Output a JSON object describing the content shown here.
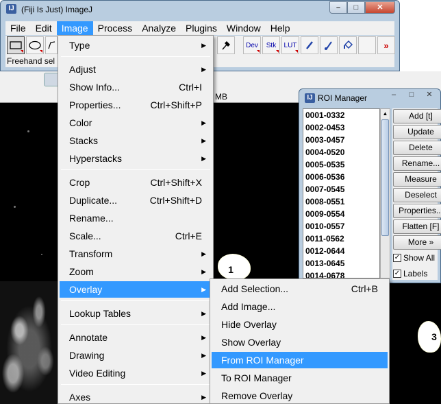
{
  "window": {
    "title": "(Fiji Is Just) ImageJ",
    "app_icon": "IJ"
  },
  "menubar": [
    "File",
    "Edit",
    "Image",
    "Process",
    "Analyze",
    "Plugins",
    "Window",
    "Help"
  ],
  "toolbar": {
    "status": "Freehand sel",
    "dev_label": "Dev",
    "stk_label": "Stk",
    "lut_label": "LUT",
    "more_label": "»"
  },
  "image_window": {
    "size_info": "MB"
  },
  "image_menu": {
    "items": [
      {
        "label": "Type",
        "shortcut": "",
        "submenu": true
      },
      {
        "label": "Adjust",
        "shortcut": "",
        "submenu": true
      },
      {
        "label": "Show Info...",
        "shortcut": "Ctrl+I",
        "submenu": false
      },
      {
        "label": "Properties...",
        "shortcut": "Ctrl+Shift+P",
        "submenu": false
      },
      {
        "label": "Color",
        "shortcut": "",
        "submenu": true
      },
      {
        "label": "Stacks",
        "shortcut": "",
        "submenu": true
      },
      {
        "label": "Hyperstacks",
        "shortcut": "",
        "submenu": true
      },
      {
        "label": "Crop",
        "shortcut": "Ctrl+Shift+X",
        "submenu": false
      },
      {
        "label": "Duplicate...",
        "shortcut": "Ctrl+Shift+D",
        "submenu": false
      },
      {
        "label": "Rename...",
        "shortcut": "",
        "submenu": false
      },
      {
        "label": "Scale...",
        "shortcut": "Ctrl+E",
        "submenu": false
      },
      {
        "label": "Transform",
        "shortcut": "",
        "submenu": true
      },
      {
        "label": "Zoom",
        "shortcut": "",
        "submenu": true
      },
      {
        "label": "Overlay",
        "shortcut": "",
        "submenu": true
      },
      {
        "label": "Lookup Tables",
        "shortcut": "",
        "submenu": true
      },
      {
        "label": "Annotate",
        "shortcut": "",
        "submenu": true
      },
      {
        "label": "Drawing",
        "shortcut": "",
        "submenu": true
      },
      {
        "label": "Video Editing",
        "shortcut": "",
        "submenu": true
      },
      {
        "label": "Axes",
        "shortcut": "",
        "submenu": true
      }
    ]
  },
  "overlay_submenu": {
    "items": [
      {
        "label": "Add Selection...",
        "shortcut": "Ctrl+B"
      },
      {
        "label": "Add Image...",
        "shortcut": ""
      },
      {
        "label": "Hide Overlay",
        "shortcut": ""
      },
      {
        "label": "Show Overlay",
        "shortcut": ""
      },
      {
        "label": "From ROI Manager",
        "shortcut": ""
      },
      {
        "label": "To ROI Manager",
        "shortcut": ""
      },
      {
        "label": "Remove Overlay",
        "shortcut": ""
      }
    ]
  },
  "roi_manager": {
    "title": "ROI Manager",
    "rois": [
      "0001-0332",
      "0002-0453",
      "0003-0457",
      "0004-0520",
      "0005-0535",
      "0006-0536",
      "0007-0545",
      "0008-0551",
      "0009-0554",
      "0010-0557",
      "0011-0562",
      "0012-0644",
      "0013-0645",
      "0014-0678"
    ],
    "buttons": [
      "Add [t]",
      "Update",
      "Delete",
      "Rename...",
      "Measure",
      "Deselect",
      "Properties...",
      "Flatten [F]",
      "More »"
    ],
    "show_all_label": "Show All",
    "labels_label": "Labels",
    "show_all_checked": true,
    "labels_checked": true
  },
  "roi_markers": [
    "1",
    "3"
  ],
  "colors": {
    "highlight": "#3399ff",
    "titlebar": "#b9cde0",
    "close_button": "#c6452f"
  }
}
